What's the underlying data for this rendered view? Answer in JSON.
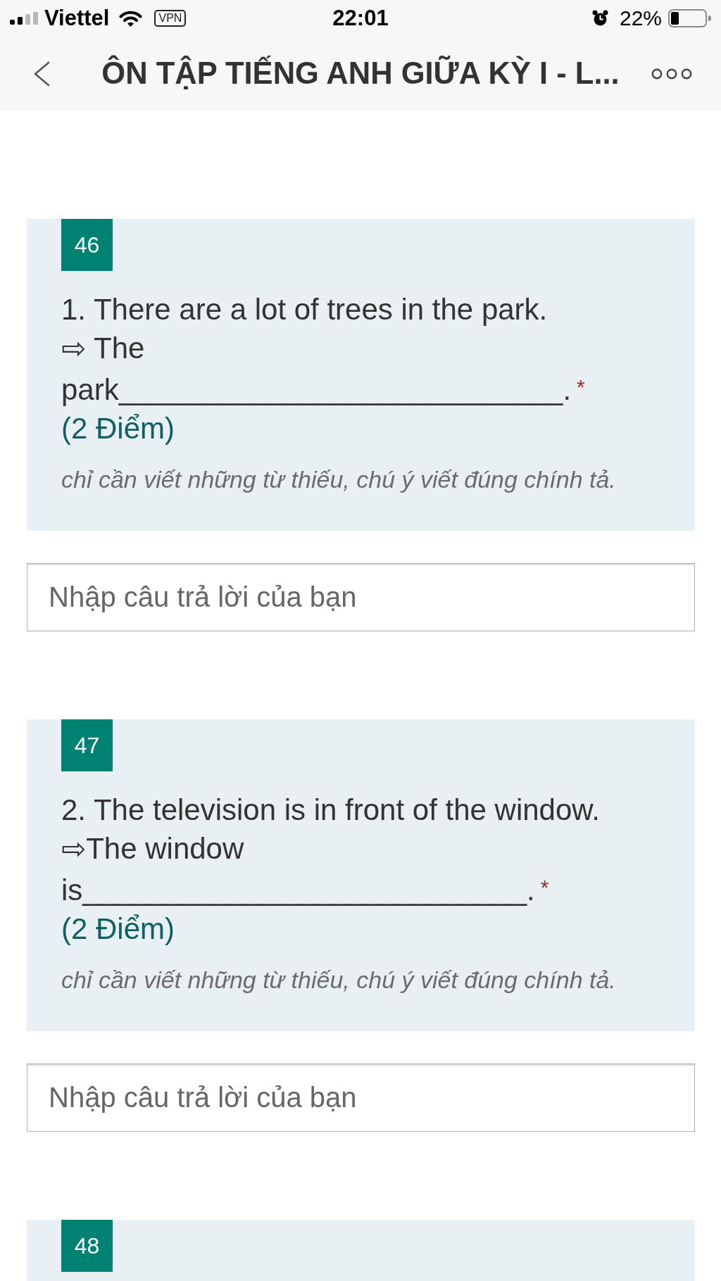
{
  "status_bar": {
    "carrier": "Viettel",
    "vpn": "VPN",
    "time": "22:01",
    "battery": "22%"
  },
  "nav_bar": {
    "title": "ÔN TẬP TIẾNG ANH GIỮA KỲ I - L..."
  },
  "questions": [
    {
      "number": "46",
      "title": "1. There are a lot of trees in the park.\n⇨ The park___________________________.",
      "required_mark": "*",
      "points": "(2 Điểm)",
      "hint": "chỉ cần viết những từ thiếu, chú ý viết đúng chính tả.",
      "answer": {
        "placeholder": "Nhập câu trả lời của bạn"
      }
    },
    {
      "number": "47",
      "title": "2. The television is in front of the window.\n⇨The window is___________________________.",
      "required_mark": "*",
      "points": "(2 Điểm)",
      "hint": "chỉ cần viết những từ thiếu, chú ý viết đúng chính tả.",
      "answer": {
        "placeholder": "Nhập câu trả lời của bạn"
      }
    },
    {
      "number": "48"
    }
  ]
}
